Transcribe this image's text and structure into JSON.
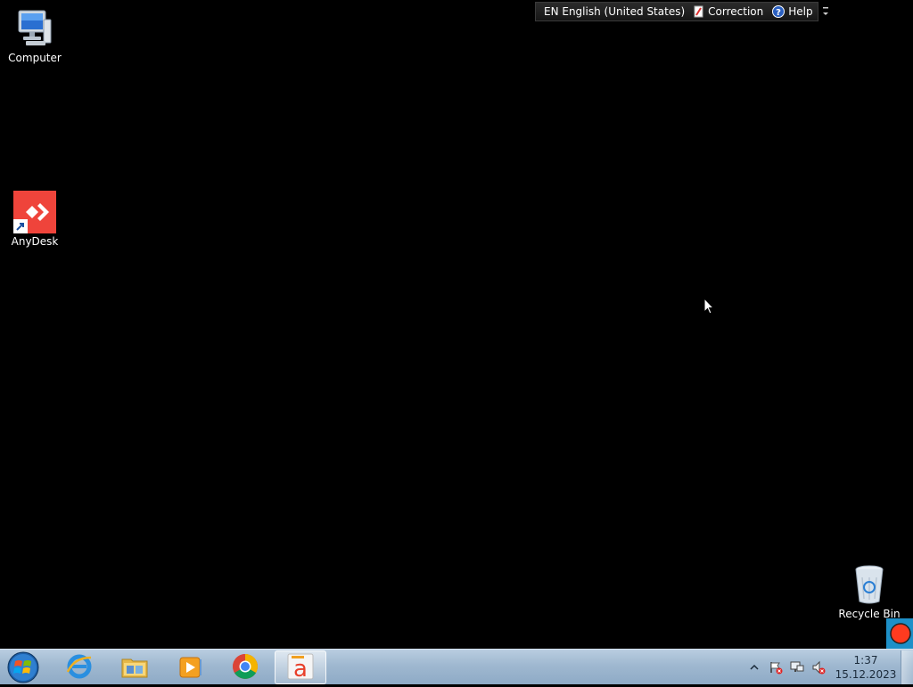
{
  "desktop": {
    "icons": [
      {
        "label": "Computer",
        "icon": "computer-icon"
      },
      {
        "label": "AnyDesk",
        "icon": "anydesk-icon"
      },
      {
        "label": "Recycle Bin",
        "icon": "recycle-bin-icon"
      }
    ]
  },
  "langbar": {
    "language": "EN English (United States)",
    "correction": "Correction",
    "help": "Help"
  },
  "taskbar": {
    "pinned": [
      {
        "name": "internet-explorer",
        "icon": "internet-explorer-icon"
      },
      {
        "name": "windows-explorer",
        "icon": "folder-icon"
      },
      {
        "name": "media-player",
        "icon": "media-player-icon"
      },
      {
        "name": "chrome",
        "icon": "chrome-icon"
      },
      {
        "name": "app-a",
        "icon": "app-a-icon",
        "active": true
      }
    ],
    "clock": {
      "time": "1:37",
      "date": "15.12.2023"
    }
  },
  "colors": {
    "taskbar": "#9fb8d0",
    "anydesk": "#ef443b",
    "record": "#ff3b1f"
  }
}
